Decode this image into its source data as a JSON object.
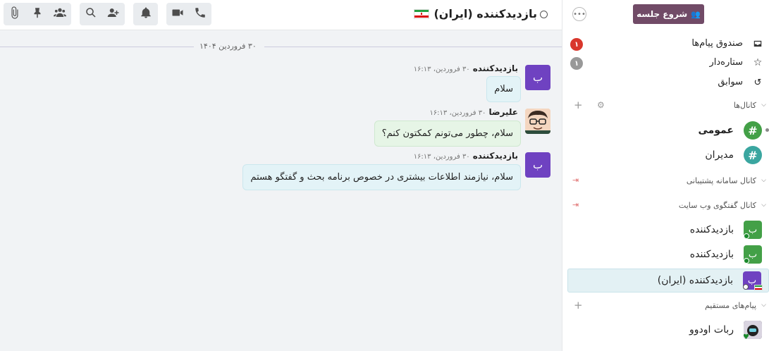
{
  "header": {
    "thread_title": "بازدیدکننده (ایران)"
  },
  "toolbar": {
    "icons": [
      "video-call-icon",
      "phone-call-icon",
      "notifications-icon",
      "add-users-icon",
      "search-icon",
      "attachments-icon",
      "pinned-icon",
      "members-icon"
    ]
  },
  "conversation": {
    "date_separator": "۳۰ فروردین ۱۴۰۴",
    "messages": [
      {
        "avatar_letter": "ب",
        "author": "بازدیدکننده",
        "time": "۳۰ فروردین، ۱۶:۱۳",
        "text": "سلام"
      },
      {
        "avatar_letter": "",
        "author": "علیرضا",
        "time": "۳۰ فروردین، ۱۶:۱۳",
        "text": "سلام، چطور می‌تونم کمکتون کنم؟"
      },
      {
        "avatar_letter": "ب",
        "author": "بازدیدکننده",
        "time": "۳۰ فروردین، ۱۶:۱۳",
        "text": "سلام، نیازمند اطلاعات بیشتری در خصوص برنامه بحث و گفتگو هستم"
      }
    ]
  },
  "sidebar": {
    "start_meeting": "شروع جلسه",
    "mailboxes": [
      {
        "label": "صندوق پیام‌ها",
        "icon": "inbox-icon",
        "count": "۱",
        "badge_color": "#d9372c"
      },
      {
        "label": "ستاره‌دار",
        "icon": "star-icon",
        "count": "۱",
        "badge_color": "#999999"
      },
      {
        "label": "سوابق",
        "icon": "history-icon",
        "count": "",
        "badge_color": ""
      }
    ],
    "channels_header": "کانال‌ها",
    "channels": [
      {
        "label": "عمومی",
        "bold": true,
        "color": "#43a047"
      },
      {
        "label": "مدیران",
        "bold": false,
        "color": "#3aa6a0"
      }
    ],
    "support_header": "کانال سامانه پشتیبانی",
    "website_header": "کانال گفتگوی وب سایت",
    "livechats": [
      {
        "letter": "ب",
        "label": "بازدیدکننده",
        "color": "#43a047"
      },
      {
        "letter": "ب",
        "label": "بازدیدکننده",
        "color": "#43a047"
      },
      {
        "letter": "ب",
        "label": "بازدیدکننده (ایران)",
        "color": "#6f42c1"
      }
    ],
    "dm_header": "پیام‌های مستقیم",
    "direct_messages": [
      {
        "label": "ربات اودوو"
      }
    ]
  },
  "colors": {
    "accent": "#714b67",
    "visitor_avatar": "#6f42c1"
  }
}
